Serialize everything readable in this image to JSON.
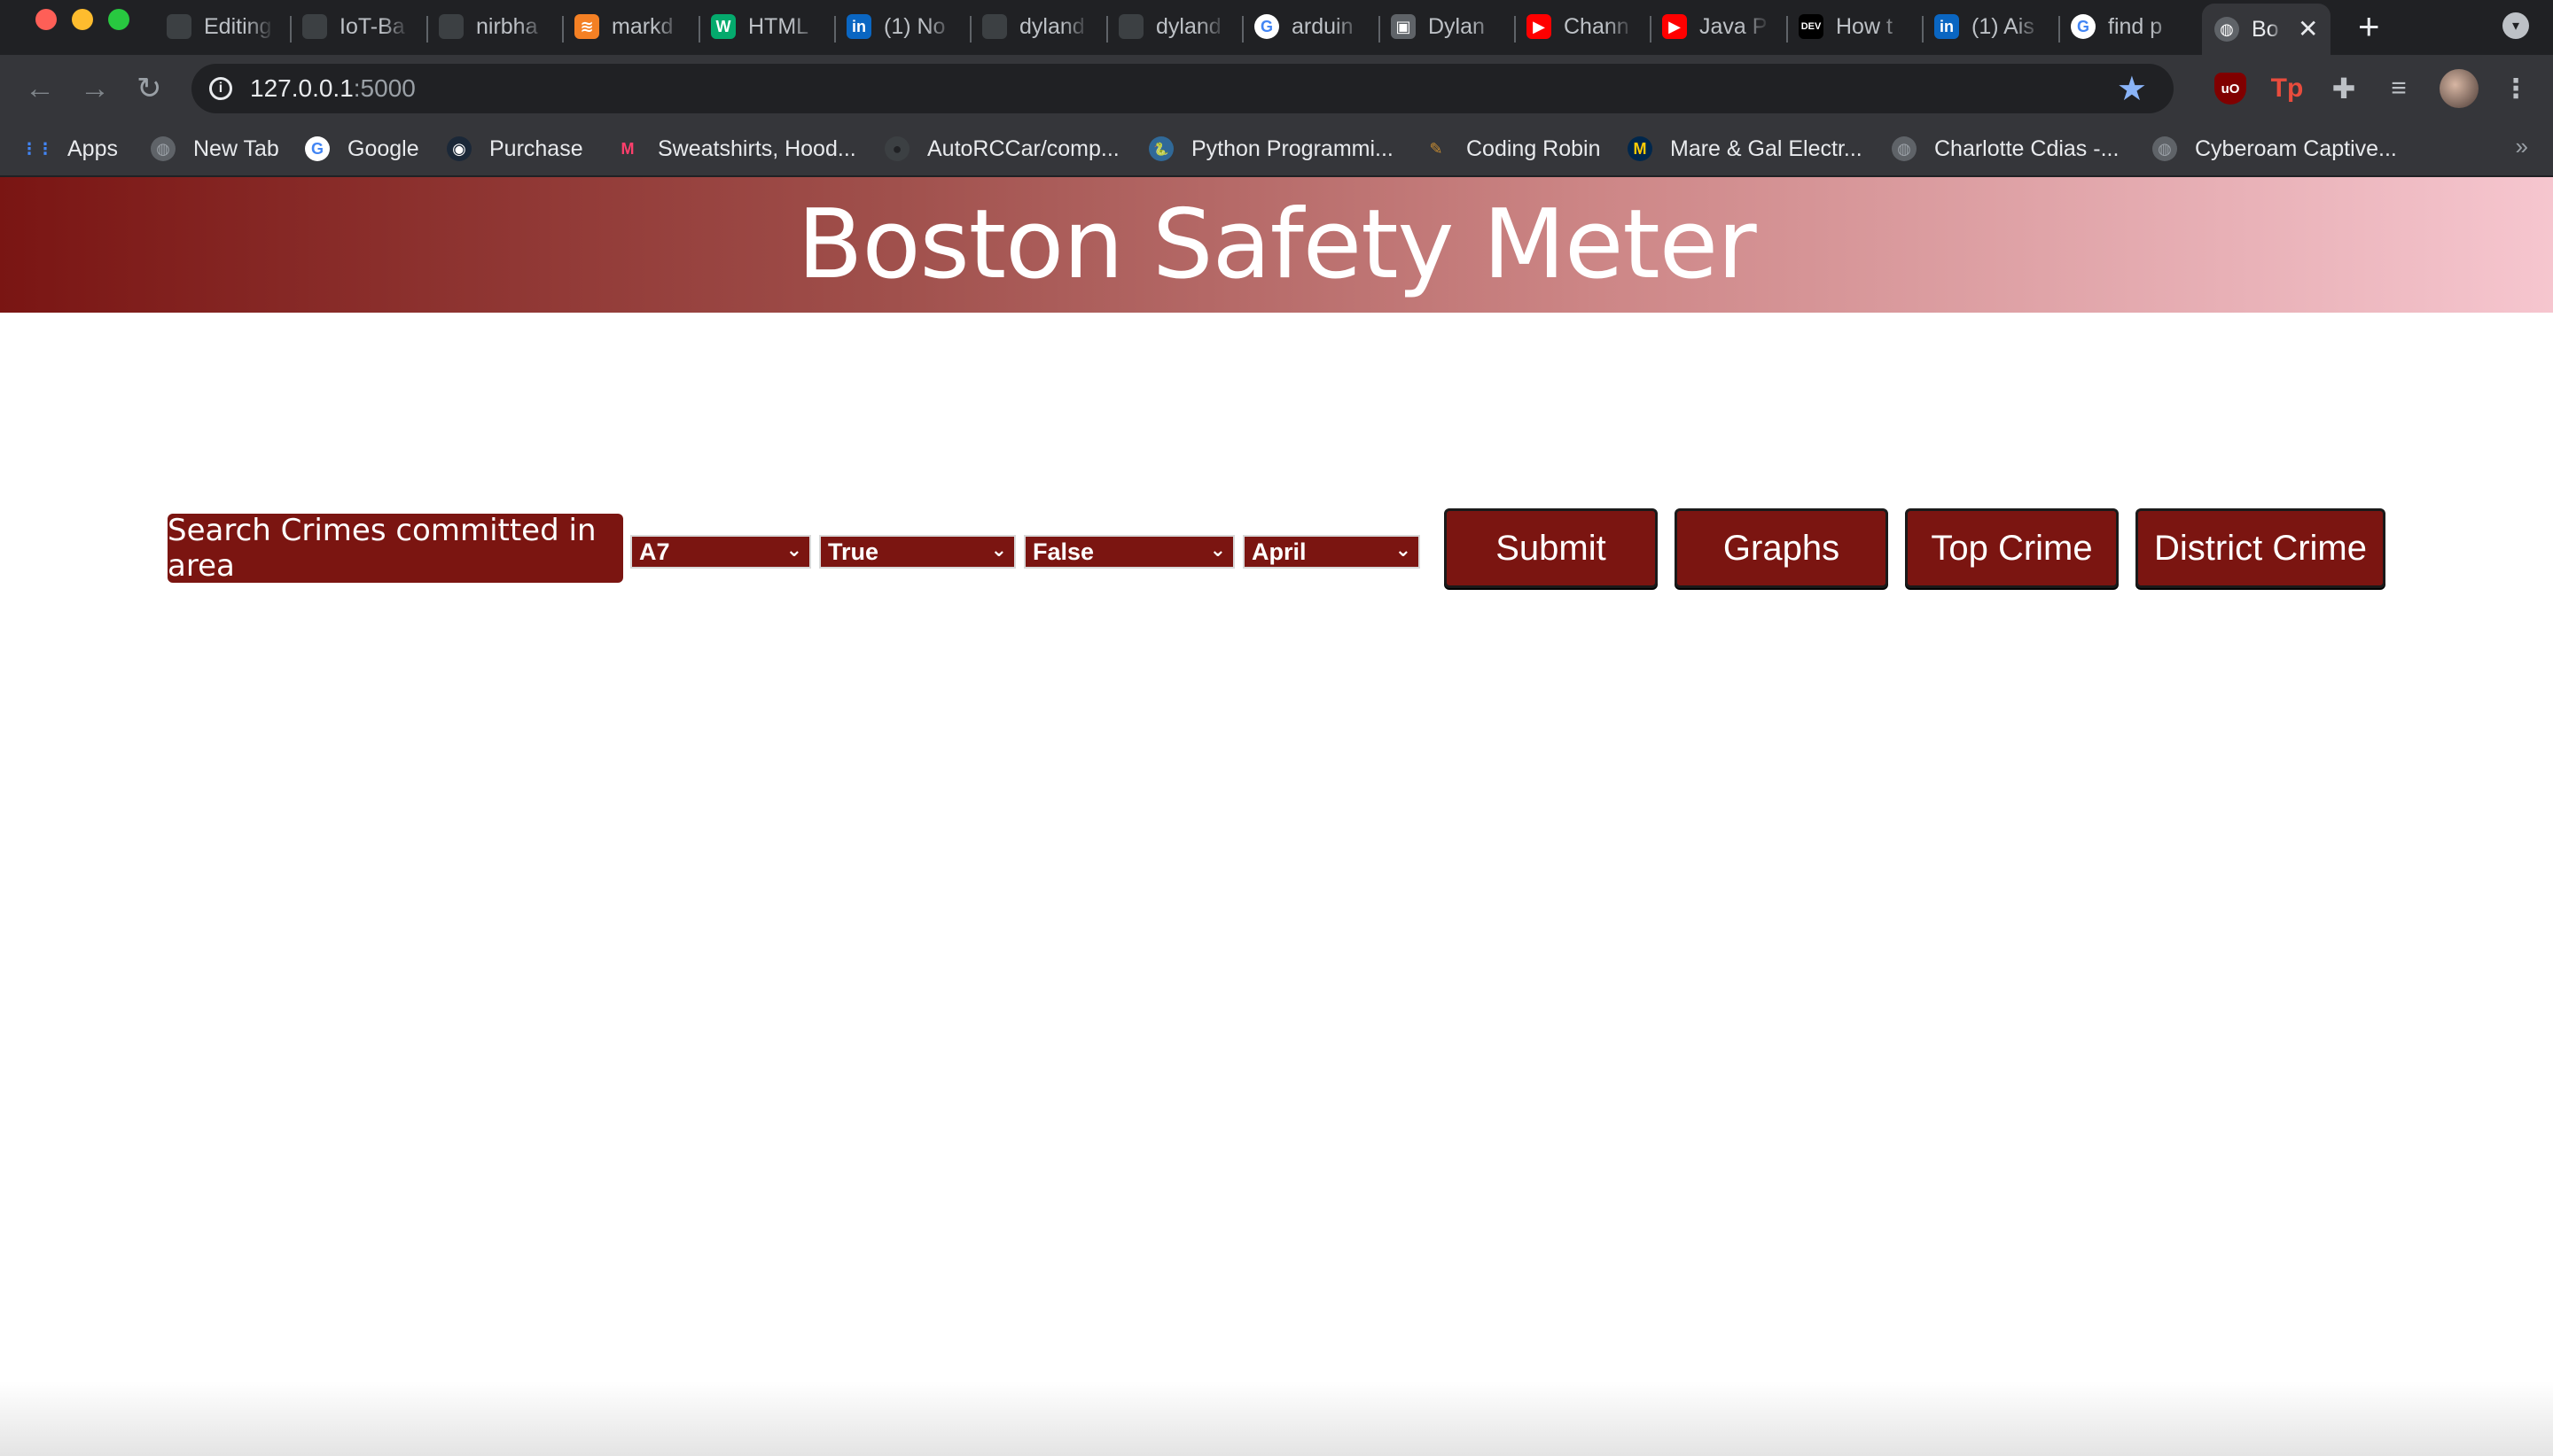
{
  "browser": {
    "tabs": [
      {
        "label": "Editing",
        "icon": "blank-tab-icon",
        "color": "#3c4043"
      },
      {
        "label": "IoT-Ba",
        "icon": "blank-tab-icon",
        "color": "#3c4043"
      },
      {
        "label": "nirbha",
        "icon": "blank-tab-icon",
        "color": "#3c4043"
      },
      {
        "label": "markd",
        "icon": "stackoverflow-icon",
        "color": "#f48024"
      },
      {
        "label": "HTML",
        "icon": "w3-icon",
        "color": "#04aa6d"
      },
      {
        "label": "(1) No",
        "icon": "linkedin-icon",
        "color": "#0a66c2"
      },
      {
        "label": "dyland",
        "icon": "blank-tab-icon",
        "color": "#3c4043"
      },
      {
        "label": "dyland",
        "icon": "blank-tab-icon",
        "color": "#3c4043"
      },
      {
        "label": "arduin",
        "icon": "google-icon",
        "color": "#ffffff"
      },
      {
        "label": "Dylan",
        "icon": "folder-icon",
        "color": "#5f6368"
      },
      {
        "label": "Chann",
        "icon": "youtube-icon",
        "color": "#ff0000"
      },
      {
        "label": "Java P",
        "icon": "youtube-icon",
        "color": "#ff0000"
      },
      {
        "label": "How t",
        "icon": "dev-icon",
        "color": "#000000"
      },
      {
        "label": "(1) Ais",
        "icon": "linkedin-icon",
        "color": "#0a66c2"
      },
      {
        "label": "find p",
        "icon": "google-icon",
        "color": "#ffffff"
      }
    ],
    "active_tab": {
      "label": "Bo",
      "icon": "globe-icon"
    },
    "new_tab_symbol": "+",
    "url_host": "127.0.0.1",
    "url_port": ":5000",
    "bookmarks": [
      {
        "label": "Apps",
        "icon": "apps-grid-icon"
      },
      {
        "label": "New Tab",
        "icon": "globe-icon"
      },
      {
        "label": "Google",
        "icon": "google-icon"
      },
      {
        "label": "Purchase",
        "icon": "steam-icon"
      },
      {
        "label": "Sweatshirts, Hood...",
        "icon": "myntra-icon"
      },
      {
        "label": "AutoRCCar/comp...",
        "icon": "github-icon"
      },
      {
        "label": "Python Programmi...",
        "icon": "python-icon"
      },
      {
        "label": "Coding Robin",
        "icon": "robin-icon"
      },
      {
        "label": "Mare & Gal Electr...",
        "icon": "michigan-icon"
      },
      {
        "label": "Charlotte Cdias -...",
        "icon": "globe-icon"
      },
      {
        "label": "Cyberoam Captive...",
        "icon": "globe-icon"
      }
    ],
    "bookmarks_more": "»"
  },
  "page": {
    "title": "Boston Safety Meter",
    "search_label": "Search Crimes committed in area",
    "selects": {
      "district": "A7",
      "shooting": "True",
      "night": "False",
      "month": "April"
    },
    "buttons": {
      "submit": "Submit",
      "graphs": "Graphs",
      "top_crime": "Top Crime",
      "district_crime": "District Crime"
    }
  },
  "colors": {
    "brand_red": "#7b1511",
    "banner_gradient_start": "#7a1513",
    "banner_gradient_end": "#f6c6cf"
  }
}
